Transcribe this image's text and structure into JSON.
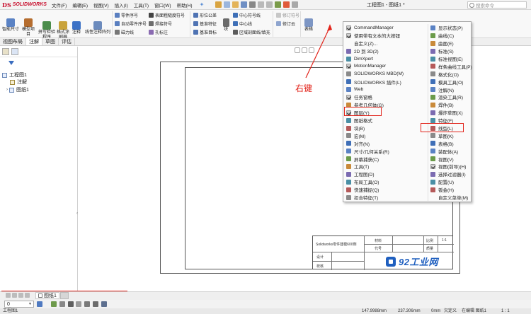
{
  "app": {
    "logo_prefix": "DS",
    "logo_name": "SOLIDWORKS",
    "window_title": "工程图1 - 图纸1 *",
    "search_placeholder": "搜索命令"
  },
  "menu": [
    "文件(F)",
    "编辑(E)",
    "视图(V)",
    "插入(I)",
    "工具(T)",
    "窗口(W)",
    "帮助(H)"
  ],
  "ribbon": {
    "large_buttons": [
      "智能尺寸",
      "模型项目",
      "拼写检验程序",
      "格式涂刷器",
      "注释",
      "线性注释阵列",
      "块",
      "表格"
    ],
    "small_buttons": [
      "零件序号",
      "自动零件序号",
      "磁力线",
      "表面粗糙度符号",
      "焊接符号",
      "孔标注",
      "形位公差",
      "基准特征",
      "基准目标",
      "中心符号线",
      "中心线",
      "区域剖面线/填充",
      "修订符号",
      "修订云"
    ]
  },
  "tabs": [
    "视图布局",
    "注解",
    "草图",
    "评估"
  ],
  "tree": {
    "root": "工程图1",
    "items": [
      "注解",
      "图纸1"
    ]
  },
  "annotation": {
    "label": "右键",
    "color": "#e2231a"
  },
  "context_menu": {
    "left_column": [
      {
        "label": "CommandManager",
        "checked": true
      },
      {
        "label": "使用带有文本的大按钮",
        "checked": true
      },
      {
        "label": "自定义(Z)...",
        "checked": false,
        "icon": false
      },
      {
        "label": "2D 到 3D(2)",
        "checked": false
      },
      {
        "label": "DimXpert",
        "checked": false
      },
      {
        "label": "MotionManager",
        "checked": true
      },
      {
        "label": "SOLIDWORKS MBD(M)",
        "checked": false
      },
      {
        "label": "SOLIDWORKS 插件(L)",
        "checked": false
      },
      {
        "label": "Web",
        "checked": false
      },
      {
        "label": "任务窗格",
        "checked": true
      },
      {
        "label": "参考几何体(G)",
        "checked": false
      },
      {
        "label": "图层(Y)",
        "checked": true
      },
      {
        "label": "图纸格式",
        "checked": false
      },
      {
        "label": "块(B)",
        "checked": false
      },
      {
        "label": "宏(M)",
        "checked": false
      },
      {
        "label": "对齐(N)",
        "checked": false
      },
      {
        "label": "尺寸/几何关系(R)",
        "checked": false
      },
      {
        "label": "屏幕捕获(C)",
        "checked": false
      },
      {
        "label": "工具(T)",
        "checked": false
      },
      {
        "label": "工程图(D)",
        "checked": false
      },
      {
        "label": "布局工具(O)",
        "checked": false
      },
      {
        "label": "快速捕捉(Q)",
        "checked": false
      },
      {
        "label": "扣合特征(T)",
        "checked": false
      }
    ],
    "right_column": [
      {
        "label": "显示状态(P)",
        "checked": false
      },
      {
        "label": "曲线(C)",
        "checked": false
      },
      {
        "label": "曲面(E)",
        "checked": false
      },
      {
        "label": "标准(S)",
        "checked": false
      },
      {
        "label": "标准视图(E)",
        "checked": false
      },
      {
        "label": "样条曲线工具(P)",
        "checked": false
      },
      {
        "label": "格式化(O)",
        "checked": false
      },
      {
        "label": "模具工具(O)",
        "checked": false
      },
      {
        "label": "注解(N)",
        "checked": false
      },
      {
        "label": "渲染工具(R)",
        "checked": false
      },
      {
        "label": "焊件(B)",
        "checked": false
      },
      {
        "label": "爆炸草图(X)",
        "checked": false
      },
      {
        "label": "特征(F)",
        "checked": false
      },
      {
        "label": "线型(L)",
        "checked": false
      },
      {
        "label": "草图(K)",
        "checked": false
      },
      {
        "label": "表格(B)",
        "checked": false
      },
      {
        "label": "装配体(A)",
        "checked": false
      },
      {
        "label": "视图(V)",
        "checked": false
      },
      {
        "label": "视图(前导)(H)",
        "checked": true
      },
      {
        "label": "选择过滤器(I)",
        "checked": false
      },
      {
        "label": "配置(U)",
        "checked": false
      },
      {
        "label": "钣金(H)",
        "checked": false
      },
      {
        "label": "自定义菜单(M)",
        "checked": false,
        "icon": false
      }
    ]
  },
  "drawing": {
    "title_block": {
      "name": "Solidworks零件建模600例",
      "material_label": "材料",
      "scale_label": "比例",
      "scale_value": "1:1",
      "code_label": "代号",
      "weight_label": "质量",
      "design_label": "设计",
      "check_label": "校核"
    },
    "watermark": "92工业网"
  },
  "bottom": {
    "sheet_tab": "图纸1",
    "layer_value": "0"
  },
  "status": {
    "left": "工程图1",
    "x": "147.9988mm",
    "y": "237.306mm",
    "z": "0mm",
    "state": "欠定义",
    "mode": "在编辑 图纸1",
    "scale": "1 : 1"
  }
}
